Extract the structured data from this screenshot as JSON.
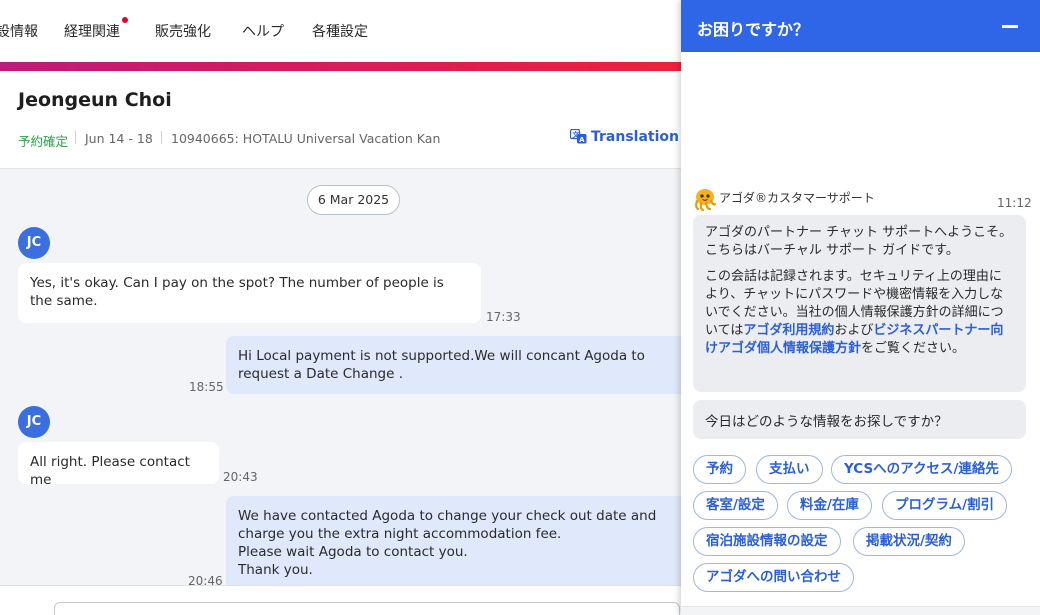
{
  "nav": {
    "items": [
      "設情報",
      "経理関連",
      "販売強化",
      "ヘルプ",
      "各種設定"
    ]
  },
  "booking": {
    "guest_name": "Jeongeun Choi",
    "status": "予約確定",
    "dates": "Jun 14 - 18",
    "property": "10940665: HOTALU Universal Vacation Kan",
    "translation_label": "Translation o"
  },
  "chat": {
    "date_divider": "6 Mar 2025",
    "guest_initials": "JC",
    "messages": [
      {
        "direction": "in",
        "text": "Yes, it's okay. Can I pay on the spot? The number of people is the same.",
        "time": "17:33"
      },
      {
        "direction": "out",
        "text": "Hi Local payment is not supported.We will concant Agoda to request a Date Change .",
        "time": "18:55"
      },
      {
        "direction": "in",
        "text": "All right. Please contact me",
        "time": "20:43"
      },
      {
        "direction": "out",
        "lines": [
          "We have contacted Agoda to change your check out date and charge you the extra night accommodation fee.",
          "Please wait Agoda to contact you.",
          "Thank you."
        ],
        "time": "20:46"
      }
    ]
  },
  "help": {
    "title": "お困りですか？",
    "agent_name": "アゴダ®カスタマーサポート",
    "agent_time": "11:12",
    "intro": "アゴダのパートナー チャット サポートへようこそ。こちらはバーチャル サポート ガイドです。",
    "notice_prefix": "この会話は記録されます。セキュリティ上の理由により、チャットにパスワードや機密情報を入力しないでください。当社の個人情報保護方針の詳細については",
    "link_terms": "アゴダ利用規約",
    "notice_and": "および",
    "link_privacy": "ビジネスパートナー向けアゴダ個人情報保護方針",
    "notice_suffix": "をご覧ください。",
    "question": "今日はどのような情報をお探しですか？",
    "chips": [
      "予約",
      "支払い",
      "YCSへのアクセス/連絡先",
      "客室/設定",
      "料金/在庫",
      "プログラム/割引",
      "宿泊施設情報の設定",
      "掲載状況/契約",
      "アゴダへの問い合わせ"
    ]
  },
  "colors": {
    "brand_blue": "#2f66e8",
    "link_blue": "#2b5fd9",
    "confirmed_green": "#2e9e4a",
    "avatar_blue": "#3b6fe0"
  }
}
